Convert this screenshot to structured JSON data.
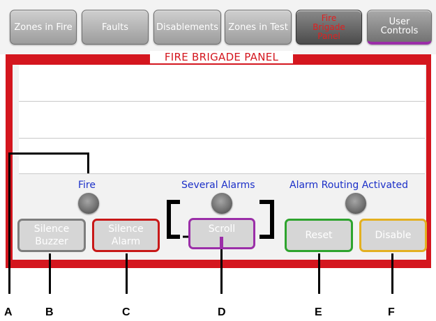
{
  "tabs": [
    {
      "label": "Zones in Fire"
    },
    {
      "label": "Faults"
    },
    {
      "label": "Disablements"
    },
    {
      "label": "Zones in Test"
    },
    {
      "label": "Fire\nBrigade\nPanel"
    },
    {
      "label": "User Controls"
    }
  ],
  "panel": {
    "title": "FIRE BRIGADE PANEL"
  },
  "indicators": {
    "fire": "Fire",
    "several_alarms": "Several Alarms",
    "alarm_routing": "Alarm Routing Activated"
  },
  "buttons": {
    "silence_buzzer": [
      "Silence",
      "Buzzer"
    ],
    "silence_alarm": [
      "Silence",
      "Alarm"
    ],
    "scroll": "Scroll",
    "reset": "Reset",
    "disable": "Disable"
  },
  "callouts": {
    "a": "A",
    "b": "B",
    "c": "C",
    "d": "D",
    "e": "E",
    "f": "F"
  },
  "colors": {
    "frame_red": "#d4161e",
    "indicator_blue": "#1b2fc8",
    "silence_buzzer_border": "#7e7e7e",
    "silence_alarm_border": "#c81818",
    "scroll_border": "#9b2ea8",
    "reset_border": "#2ea42e",
    "disable_border": "#e3b020"
  }
}
